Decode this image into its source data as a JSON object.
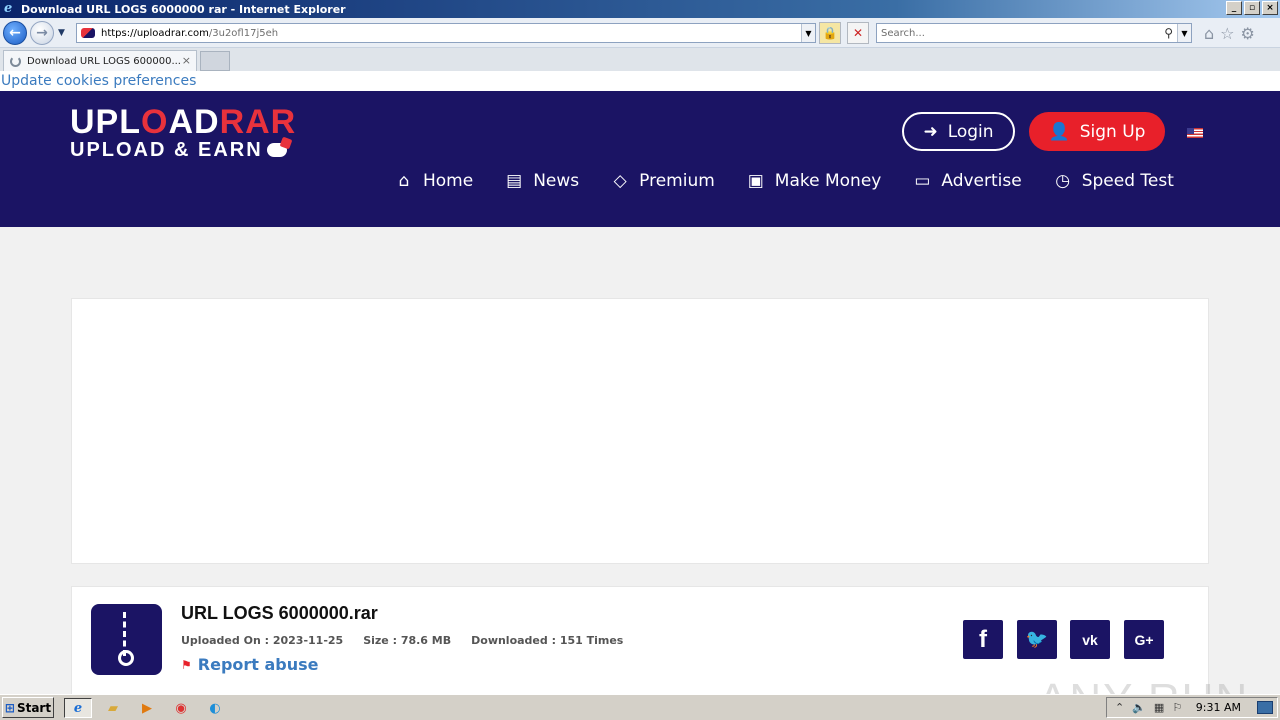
{
  "window": {
    "title": "Download URL LOGS 6000000 rar - Internet Explorer",
    "controls": [
      "_",
      "▫",
      "×"
    ]
  },
  "address_bar": {
    "host": "https://uploadrar.com",
    "path": "/3u2ofl17j5eh"
  },
  "search": {
    "placeholder": "Search..."
  },
  "tabs": [
    {
      "label": "Download URL LOGS 600000...",
      "close": "×"
    }
  ],
  "cookie_link": "Update cookies preferences",
  "logo": {
    "upload": "UPL",
    "o": "O",
    "ad": "AD",
    "rar": "RAR",
    "tagline": "UPLOAD & EARN"
  },
  "header": {
    "login_label": "Login",
    "signup_label": "Sign Up",
    "nav": [
      {
        "label": "Home",
        "icon": "home-icon",
        "glyph": "⌂"
      },
      {
        "label": "News",
        "icon": "newspaper-icon",
        "glyph": "▤"
      },
      {
        "label": "Premium",
        "icon": "diamond-icon",
        "glyph": "◇"
      },
      {
        "label": "Make Money",
        "icon": "money-icon",
        "glyph": "▣"
      },
      {
        "label": "Advertise",
        "icon": "card-icon",
        "glyph": "▭"
      },
      {
        "label": "Speed Test",
        "icon": "clock-icon",
        "glyph": "◷"
      }
    ]
  },
  "file": {
    "name": "URL LOGS 6000000.rar",
    "uploaded_on": "Uploaded On : 2023-11-25",
    "size": "Size : 78.6 MB",
    "downloaded": "Downloaded : 151 Times",
    "report": "Report abuse"
  },
  "share": {
    "facebook": "f",
    "twitter": "🐦",
    "vk": "vk",
    "googleplus": "G+"
  },
  "watermark": "ANY RUN",
  "taskbar": {
    "start": "Start",
    "clock": "9:31 AM"
  },
  "colors": {
    "brand": "#1b1464",
    "accent": "#e8202a",
    "link": "#3b7bbf"
  }
}
